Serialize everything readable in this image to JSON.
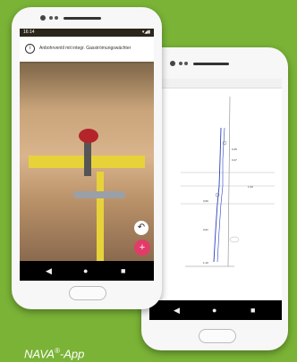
{
  "caption": {
    "brand": "NAVA",
    "reg": "®",
    "suffix": "-App"
  },
  "front_phone": {
    "status_time": "16:14",
    "status_icons": "▾◢▮",
    "banner_text": "Anbohrventil mit integr. Gasströmungswächter",
    "info_icon": "i",
    "undo_icon": "↶",
    "add_icon": "+"
  },
  "back_phone": {
    "drawing_labels": [
      "0,45",
      "0,47",
      "1,33",
      "0,56",
      "0,61",
      "1,10"
    ]
  },
  "nav": {
    "back": "◀",
    "home": "●",
    "recents": "■"
  },
  "colors": {
    "background": "#7ab336",
    "accent": "#e23b6a",
    "pipe": "#e8d23a",
    "valve": "#b3242b"
  }
}
